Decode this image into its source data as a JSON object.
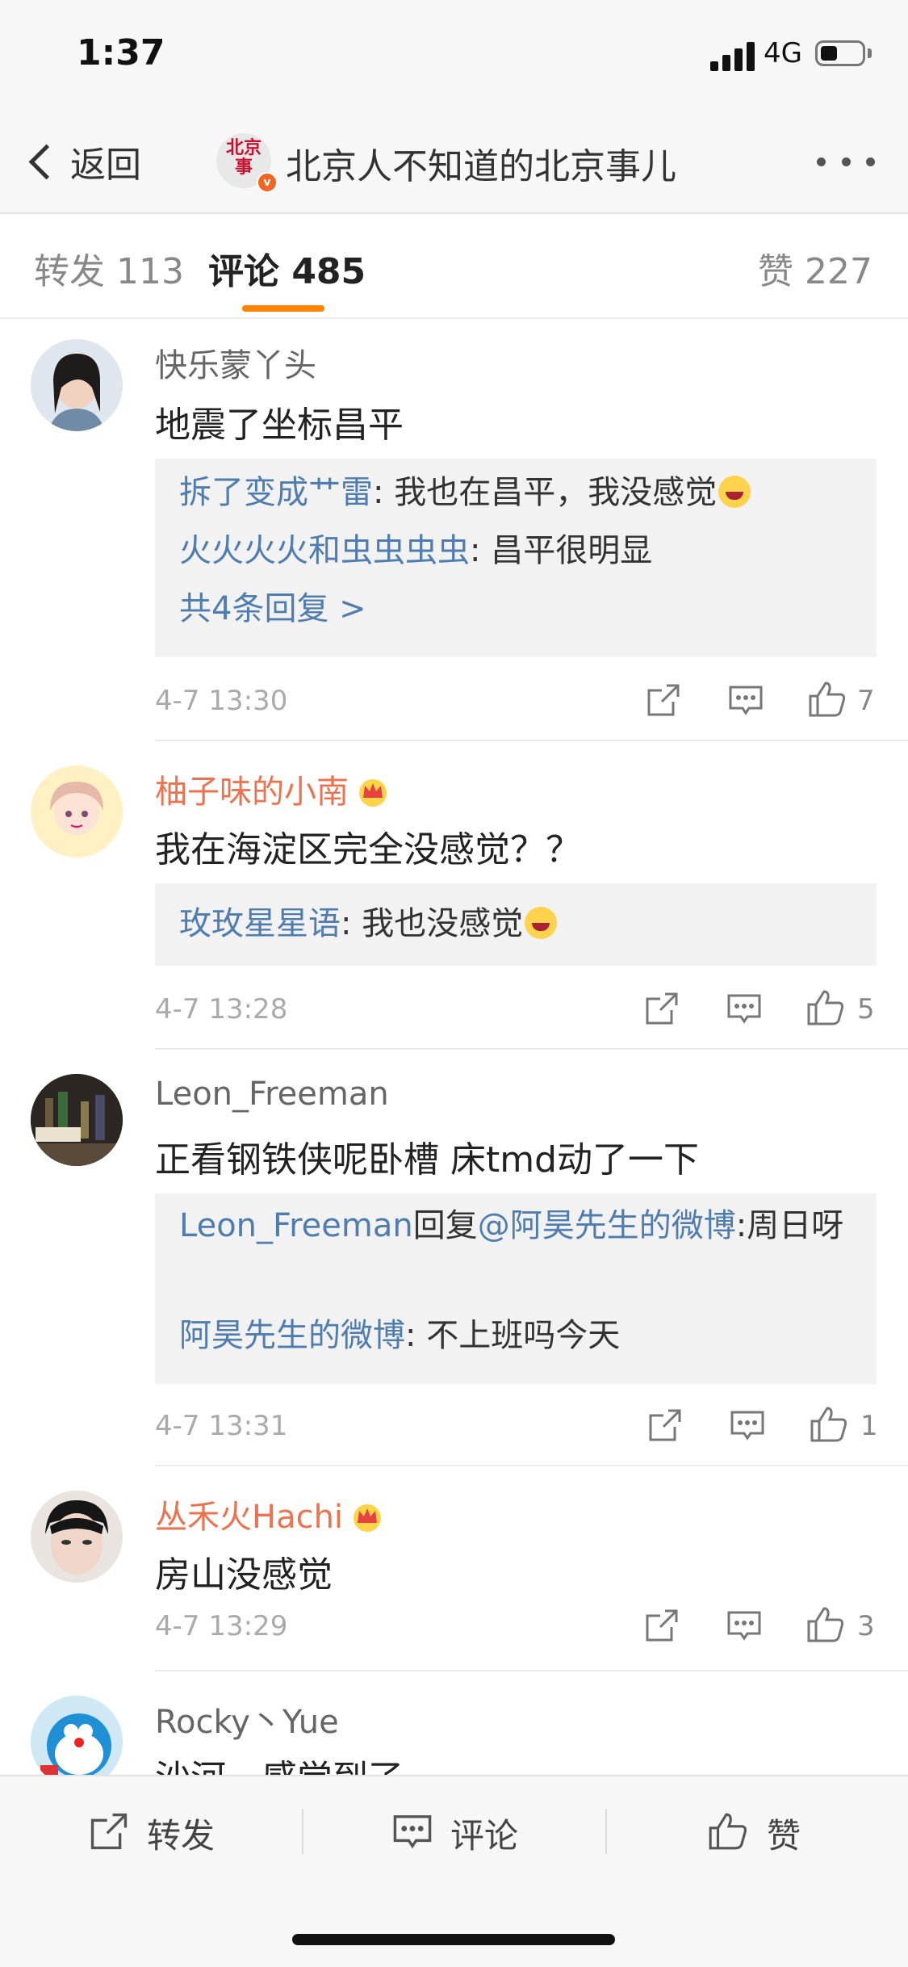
{
  "status_bar": {
    "time": "1:37",
    "network": "4G"
  },
  "nav": {
    "back_label": "返回",
    "title": "北京人不知道的北京事儿",
    "avatar_text": "北京事"
  },
  "tabs": {
    "repost": "转发 113",
    "comments": "评论 485",
    "likes": "赞 227"
  },
  "comments": [
    {
      "name": "快乐蒙丫头",
      "text": "地震了坐标昌平",
      "replies": [
        {
          "name": "拆了变成艹雷",
          "text": ": 我也在昌平，我没感觉",
          "emoji": "laugh-cry-emoji"
        },
        {
          "name": "火火火火和虫虫虫虫",
          "text": ": 昌平很明显"
        }
      ],
      "more_replies": "共4条回复 >",
      "date": "4-7 13:30",
      "likes": "7"
    },
    {
      "name": "柚子味的小南",
      "vip": true,
      "text": "我在海淀区完全没感觉？？",
      "replies": [
        {
          "name": "玫玫星星语",
          "text": ": 我也没感觉",
          "emoji": "laugh-cry-emoji"
        }
      ],
      "date": "4-7 13:28",
      "likes": "5"
    },
    {
      "name": "Leon_Freeman",
      "text": "正看钢铁侠呢卧槽 床tmd动了一下",
      "replies": [
        {
          "name": "Leon_Freeman",
          "mid": "回复",
          "mention": "@阿昊先生的微博",
          "text": ":周日呀"
        },
        {
          "name": "阿昊先生的微博",
          "text": ": 不上班吗今天"
        }
      ],
      "date": "4-7 13:31",
      "likes": "1"
    },
    {
      "name": "丛禾火Hachi",
      "vip": true,
      "text": "房山没感觉",
      "date": "4-7 13:29",
      "likes": "3"
    },
    {
      "name": "Rocky丶Yue",
      "text": "沙河，感觉到了"
    }
  ],
  "bottom_bar": {
    "repost": "转发",
    "comment": "评论",
    "like": "赞"
  },
  "colors": {
    "accent": "#ff8200",
    "link": "#507daf",
    "vip_name": "#eb7350"
  }
}
